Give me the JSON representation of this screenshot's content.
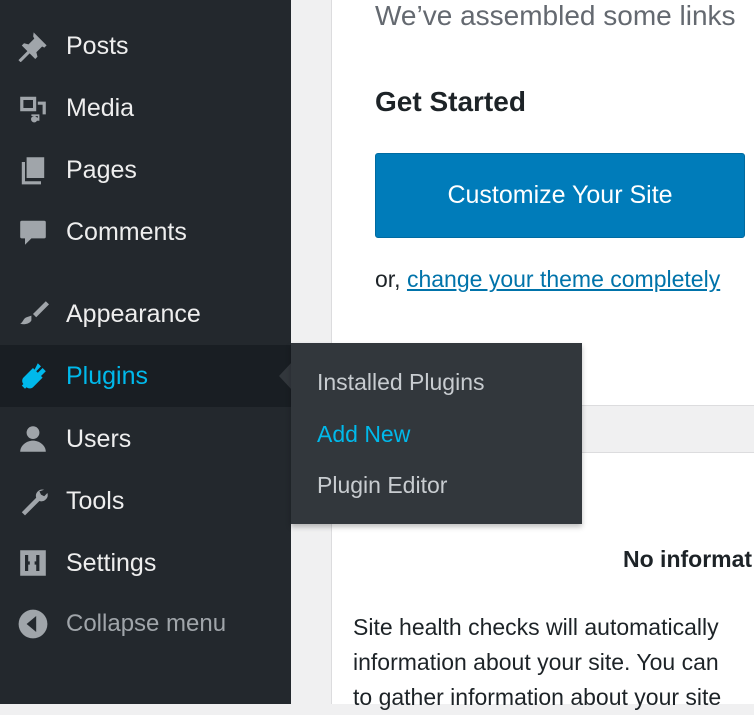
{
  "sidebar": {
    "items": [
      {
        "label": "Posts",
        "icon": "pushpin-icon"
      },
      {
        "label": "Media",
        "icon": "media-icon"
      },
      {
        "label": "Pages",
        "icon": "pages-icon"
      },
      {
        "label": "Comments",
        "icon": "comment-icon"
      },
      {
        "label": "Appearance",
        "icon": "paintbrush-icon"
      },
      {
        "label": "Plugins",
        "icon": "plugin-icon"
      },
      {
        "label": "Users",
        "icon": "user-icon"
      },
      {
        "label": "Tools",
        "icon": "wrench-icon"
      },
      {
        "label": "Settings",
        "icon": "settings-icon"
      },
      {
        "label": "Collapse menu",
        "icon": "collapse-arrow-icon"
      }
    ]
  },
  "flyout": {
    "items": [
      {
        "label": "Installed Plugins"
      },
      {
        "label": "Add New"
      },
      {
        "label": "Plugin Editor"
      }
    ]
  },
  "welcome": {
    "intro": "We’ve assembled some links",
    "heading": "Get Started",
    "cta_label": "Customize Your Site",
    "or_text": "or, ",
    "change_theme_link": "change your theme completely"
  },
  "site_health": {
    "no_info": "No informat",
    "line1": "Site health checks will automatically",
    "line2": "information about your site. You can",
    "line3": "to gather information about your site"
  },
  "colors": {
    "sidebar_bg": "#23282d",
    "accent": "#00b9eb",
    "button_blue": "#007cba",
    "link": "#0073aa"
  }
}
